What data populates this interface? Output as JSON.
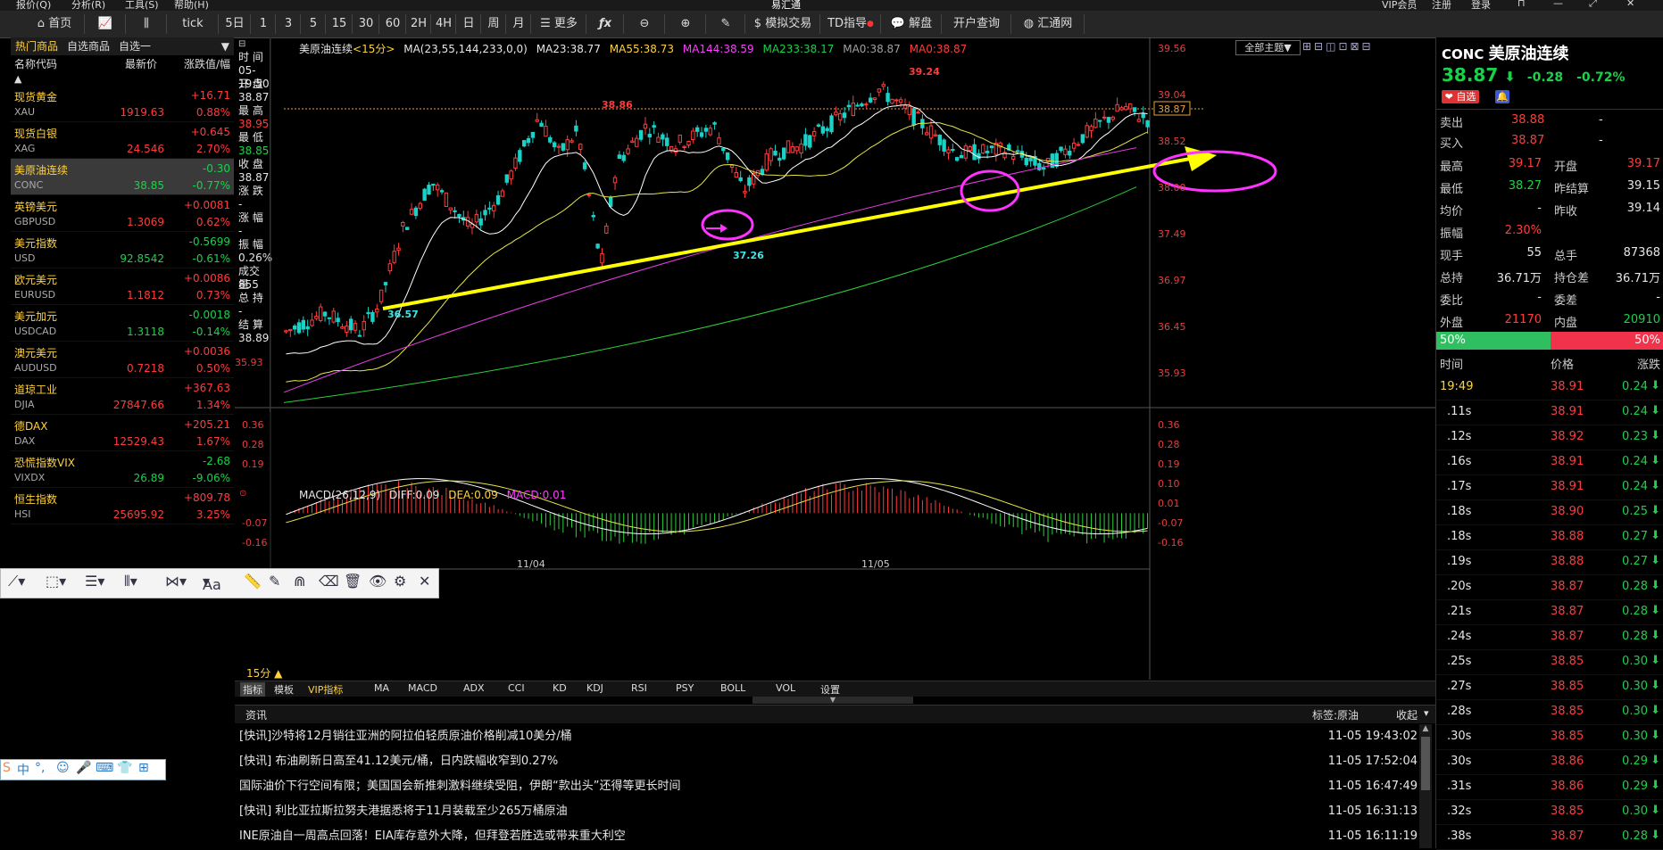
{
  "menu": [
    "报价(Q)",
    "分析(R)",
    "工具(S)",
    "帮助(H)",
    "易汇通",
    "VIP会员",
    "注册",
    "登录"
  ],
  "toolbar": {
    "home": "首页",
    "tick": "tick",
    "periods": [
      "5日",
      "1",
      "3",
      "5",
      "15",
      "30",
      "60",
      "2H",
      "4H",
      "日",
      "周",
      "月"
    ],
    "more": "更多",
    "sim_trade": "模拟交易",
    "td": "TD指导",
    "analysis": "解盘",
    "open_account": "开户查询",
    "huihui": "汇通网"
  },
  "watchlist": {
    "tabs": [
      "热门商品",
      "自选商品",
      "自选一"
    ],
    "headers": [
      "名称代码",
      "最新价",
      "涨跌值/幅"
    ],
    "items": [
      {
        "name": "现货黄金",
        "code": "XAU",
        "price": "1919.63",
        "change": "+16.71",
        "pct": "0.88%",
        "dir": "up"
      },
      {
        "name": "现货白银",
        "code": "XAG",
        "price": "24.546",
        "change": "+0.645",
        "pct": "2.70%",
        "dir": "up"
      },
      {
        "name": "美原油连续",
        "code": "CONC",
        "price": "38.85",
        "change": "-0.30",
        "pct": "-0.77%",
        "dir": "dn"
      },
      {
        "name": "英镑美元",
        "code": "GBPUSD",
        "price": "1.3069",
        "change": "+0.0081",
        "pct": "0.62%",
        "dir": "up"
      },
      {
        "name": "美元指数",
        "code": "USD",
        "price": "92.8542",
        "change": "-0.5699",
        "pct": "-0.61%",
        "dir": "dn"
      },
      {
        "name": "欧元美元",
        "code": "EURUSD",
        "price": "1.1812",
        "change": "+0.0086",
        "pct": "0.73%",
        "dir": "up"
      },
      {
        "name": "美元加元",
        "code": "USDCAD",
        "price": "1.3118",
        "change": "-0.0018",
        "pct": "-0.14%",
        "dir": "dn"
      },
      {
        "name": "澳元美元",
        "code": "AUDUSD",
        "price": "0.7218",
        "change": "+0.0036",
        "pct": "0.50%",
        "dir": "up"
      },
      {
        "name": "道琼工业",
        "code": "DJIA",
        "price": "27847.66",
        "change": "+367.63",
        "pct": "1.34%",
        "dir": "up"
      },
      {
        "name": "德DAX",
        "code": "DAX",
        "price": "12529.43",
        "change": "+205.21",
        "pct": "1.67%",
        "dir": "up"
      },
      {
        "name": "恐慌指数VIX",
        "code": "VIXDX",
        "price": "26.89",
        "change": "-2.68",
        "pct": "-9.06%",
        "dir": "dn"
      },
      {
        "name": "恒生指数",
        "code": "HSI",
        "price": "25695.92",
        "change": "+809.78",
        "pct": "3.25%",
        "dir": "up"
      }
    ]
  },
  "info": {
    "time_label": "时 间",
    "time": "05-19:50",
    "open_label": "开 盘",
    "open": "38.87",
    "high_label": "最 高",
    "high": "38.95",
    "low_label": "最 低",
    "low": "38.85",
    "close_label": "收 盘",
    "close": "38.87",
    "chg_label": "涨 跌",
    "chg": "-",
    "chgpct_label": "涨 幅",
    "chgpct": "-",
    "amp_label": "振 幅",
    "amp": "0.26%",
    "vol_label": "成交量",
    "vol": "855",
    "hold_label": "总 持",
    "hold": "-",
    "settle_label": "结 算",
    "settle": "38.89"
  },
  "chart": {
    "symbol": "美原油连续",
    "period": "<15分>",
    "ma_params": "MA(23,55,144,233,0,0)",
    "ma23": "MA23:38.77",
    "ma55": "MA55:38.73",
    "ma144": "MA144:38.59",
    "ma233": "MA233:38.17",
    "ma0a": "MA0:38.87",
    "ma0b": "MA0:38.87",
    "topic": "全部主题",
    "yaxis": [
      "39.56",
      "39.04",
      "38.52",
      "38.00",
      "37.49",
      "36.97",
      "36.45",
      "35.93"
    ],
    "left_label": "35.93",
    "price_tag": "38.87",
    "annotations": [
      "39.24",
      "38.86",
      "37.26",
      "36.57"
    ],
    "dates": [
      "11/04",
      "11/05"
    ],
    "period_label": "15分"
  },
  "macd": {
    "title": "MACD(26,12,9)",
    "diff": "DIFF:0.09",
    "dea": "DEA:0.09",
    "macd": "MACD:0.01",
    "yaxis_right": [
      "0.36",
      "0.28",
      "0.19",
      "0.10",
      "0.01",
      "-0.07",
      "-0.16"
    ],
    "yaxis_left": [
      "0.36",
      "0.28",
      "0.19",
      "-0.07",
      "-0.16"
    ]
  },
  "indicator_tabs": [
    "指标",
    "模板",
    "VIP指标",
    "MA",
    "MACD",
    "ADX",
    "CCI",
    "KD",
    "KDJ",
    "RSI",
    "PSY",
    "BOLL",
    "VOL",
    "设置"
  ],
  "news": {
    "tab": "资讯",
    "tag": "标签:原油",
    "collapse": "收起",
    "items": [
      {
        "title": "[快讯]沙特将12月销往亚洲的阿拉伯轻质原油价格削减10美分/桶",
        "time": "11-05 19:43:02"
      },
      {
        "title": "[快讯] 布油刷新日高至41.12美元/桶，日内跌幅收窄到0.27%",
        "time": "11-05 17:52:04"
      },
      {
        "title": "国际油价下行空间有限；美国国会新推刺激料继续受阻，伊朗“款出头”还得等更长时间",
        "time": "11-05 16:47:49"
      },
      {
        "title": "[快讯] 利比亚拉斯拉努夫港据悉将于11月装载至少265万桶原油",
        "time": "11-05 16:31:13"
      },
      {
        "title": "INE原油自一周高点回落！EIA库存意外大降，但拜登若胜选或带来重大利空",
        "time": "11-05 16:11:19"
      }
    ]
  },
  "quote": {
    "code": "CONC",
    "name": "美原油连续",
    "price": "38.87",
    "change": "-0.28",
    "pct": "-0.72%",
    "self_select": "自选",
    "sell_label": "卖出",
    "sell": "38.88",
    "sell_vol": "-",
    "buy_label": "买入",
    "buy": "38.87",
    "buy_vol": "-",
    "high_label": "最高",
    "high": "39.17",
    "open_label": "开盘",
    "open": "39.17",
    "low_label": "最低",
    "low": "38.27",
    "prev_settle_label": "昨结算",
    "prev_settle": "39.15",
    "avg_label": "均价",
    "avg": "-",
    "prev_close_label": "昨收",
    "prev_close": "39.14",
    "amp_label": "振幅",
    "amp": "2.30%",
    "cur_vol_label": "现手",
    "cur_vol": "55",
    "total_vol_label": "总手",
    "total_vol": "87368",
    "total_hold_label": "总持",
    "total_hold": "36.71万",
    "hold_diff_label": "持仓差",
    "hold_diff": "36.71万",
    "ratio_label": "委比",
    "ratio": "-",
    "diff_label": "委差",
    "diff": "-",
    "outer_label": "外盘",
    "outer": "21170",
    "inner_label": "内盘",
    "inner": "20910",
    "buy_share": 0.5,
    "buy_pct": "50%",
    "sell_pct": "50%"
  },
  "ticks": {
    "headers": [
      "时间",
      "价格",
      "涨跌"
    ],
    "rows": [
      {
        "time": "19:49",
        "price": "38.91",
        "chg": "0.24"
      },
      {
        "time": ".11s",
        "price": "38.91",
        "chg": "0.24"
      },
      {
        "time": ".12s",
        "price": "38.92",
        "chg": "0.23"
      },
      {
        "time": ".16s",
        "price": "38.91",
        "chg": "0.24"
      },
      {
        "time": ".17s",
        "price": "38.91",
        "chg": "0.24"
      },
      {
        "time": ".18s",
        "price": "38.90",
        "chg": "0.25"
      },
      {
        "time": ".18s",
        "price": "38.88",
        "chg": "0.27"
      },
      {
        "time": ".19s",
        "price": "38.88",
        "chg": "0.27"
      },
      {
        "time": ".20s",
        "price": "38.87",
        "chg": "0.28"
      },
      {
        "time": ".21s",
        "price": "38.87",
        "chg": "0.28"
      },
      {
        "time": ".24s",
        "price": "38.87",
        "chg": "0.28"
      },
      {
        "time": ".25s",
        "price": "38.85",
        "chg": "0.30"
      },
      {
        "time": ".27s",
        "price": "38.85",
        "chg": "0.30"
      },
      {
        "time": ".28s",
        "price": "38.85",
        "chg": "0.30"
      },
      {
        "time": ".30s",
        "price": "38.85",
        "chg": "0.30"
      },
      {
        "time": ".30s",
        "price": "38.86",
        "chg": "0.29"
      },
      {
        "time": ".31s",
        "price": "38.86",
        "chg": "0.29"
      },
      {
        "time": ".32s",
        "price": "38.85",
        "chg": "0.30"
      },
      {
        "time": ".38s",
        "price": "38.87",
        "chg": "0.28"
      }
    ]
  },
  "drawbar": {
    "font_label": "Aa"
  },
  "ime": {
    "lang": "中"
  }
}
